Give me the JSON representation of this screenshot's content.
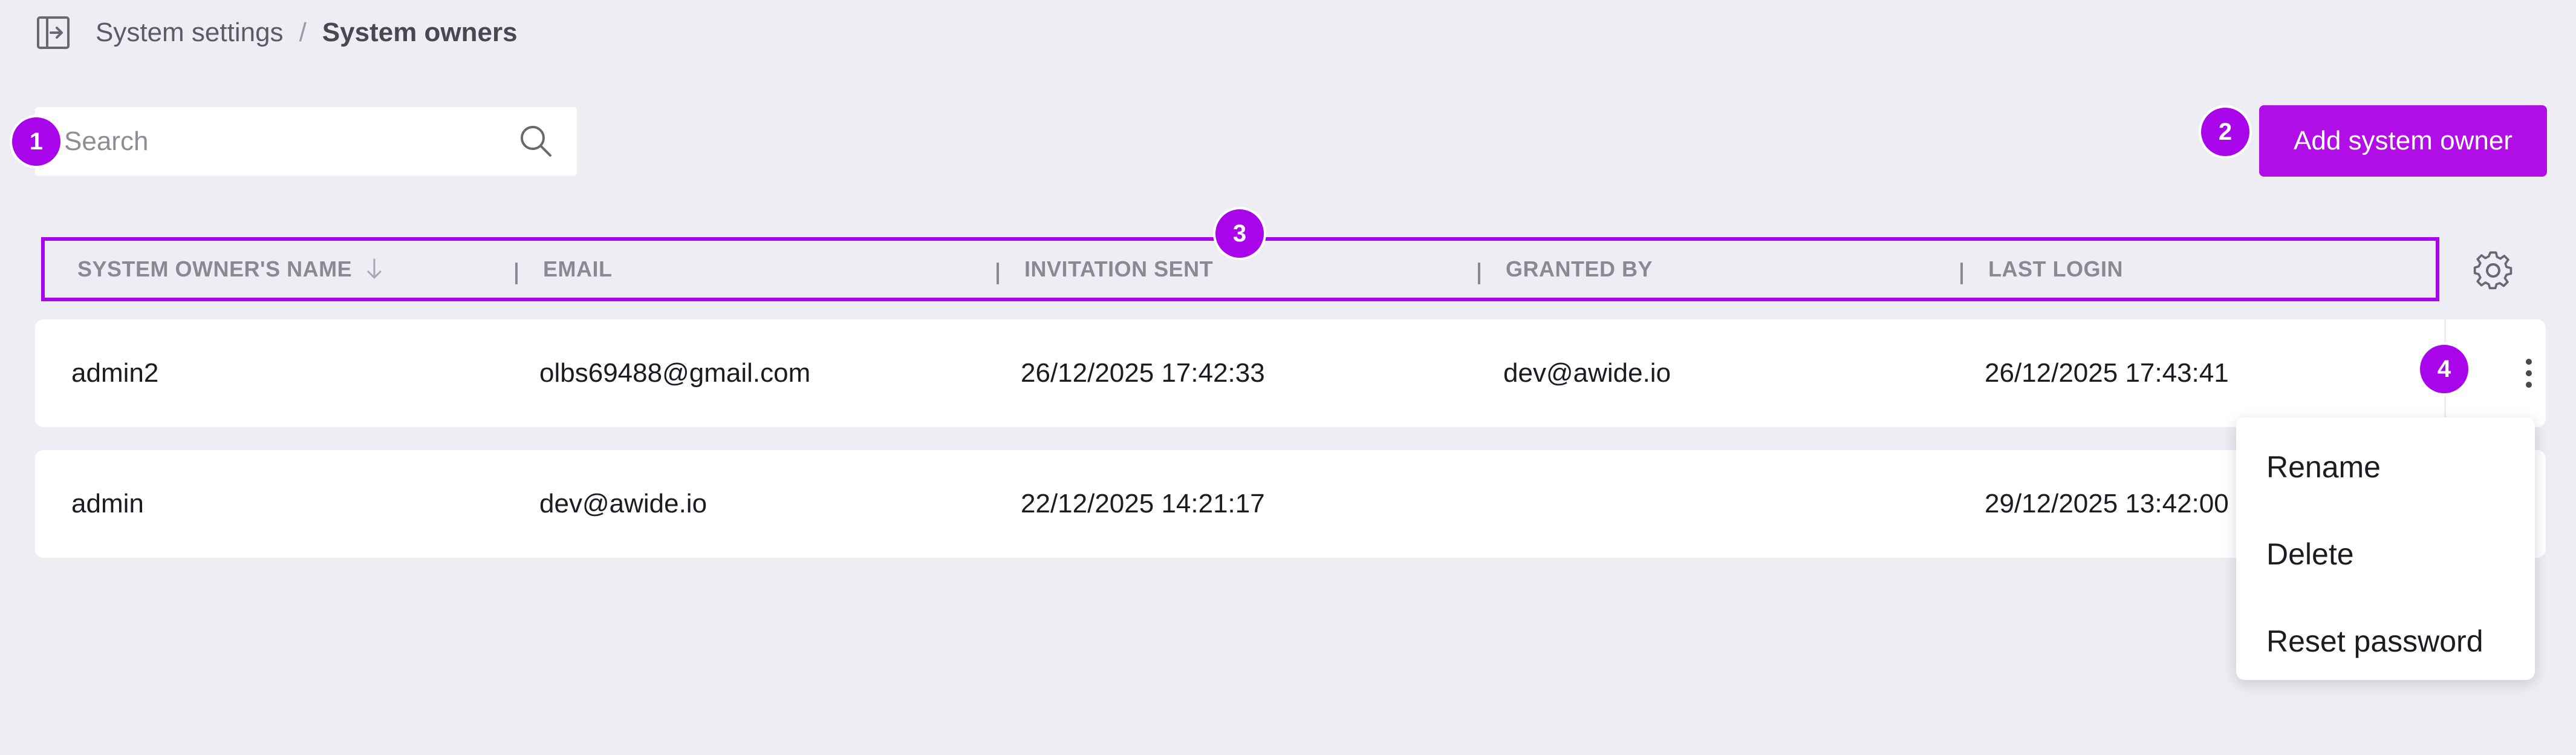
{
  "breadcrumb": {
    "parent": "System settings",
    "separator": "/",
    "current": "System owners"
  },
  "search": {
    "value": "",
    "placeholder": "Search"
  },
  "actions": {
    "add_label": "Add system owner"
  },
  "markers": [
    "1",
    "2",
    "3",
    "4"
  ],
  "table": {
    "columns": [
      "SYSTEM OWNER'S NAME",
      "EMAIL",
      "INVITATION SENT",
      "GRANTED BY",
      "LAST LOGIN"
    ],
    "sort": {
      "column": "SYSTEM OWNER'S NAME",
      "direction": "descending"
    },
    "rows": [
      {
        "name": "admin2",
        "email": "olbs69488@gmail.com",
        "invitation_sent": "26/12/2025 17:42:33",
        "granted_by": "dev@awide.io",
        "last_login": "26/12/2025 17:43:41"
      },
      {
        "name": "admin",
        "email": "dev@awide.io",
        "invitation_sent": "22/12/2025 14:21:17",
        "granted_by": "",
        "last_login": "29/12/2025 13:42:00"
      }
    ]
  },
  "row_menu": {
    "items": [
      "Rename",
      "Delete",
      "Reset password"
    ]
  },
  "colors": {
    "accent": "#a805ea",
    "button": "#b10de6",
    "background": "#eeedf3",
    "header_text": "#8b8894"
  },
  "icons": {
    "sidebar_toggle": "sidebar-toggle-icon",
    "search": "search-icon",
    "sort": "arrow-down-icon",
    "settings": "gear-icon",
    "row_actions": "kebab-menu-icon"
  }
}
